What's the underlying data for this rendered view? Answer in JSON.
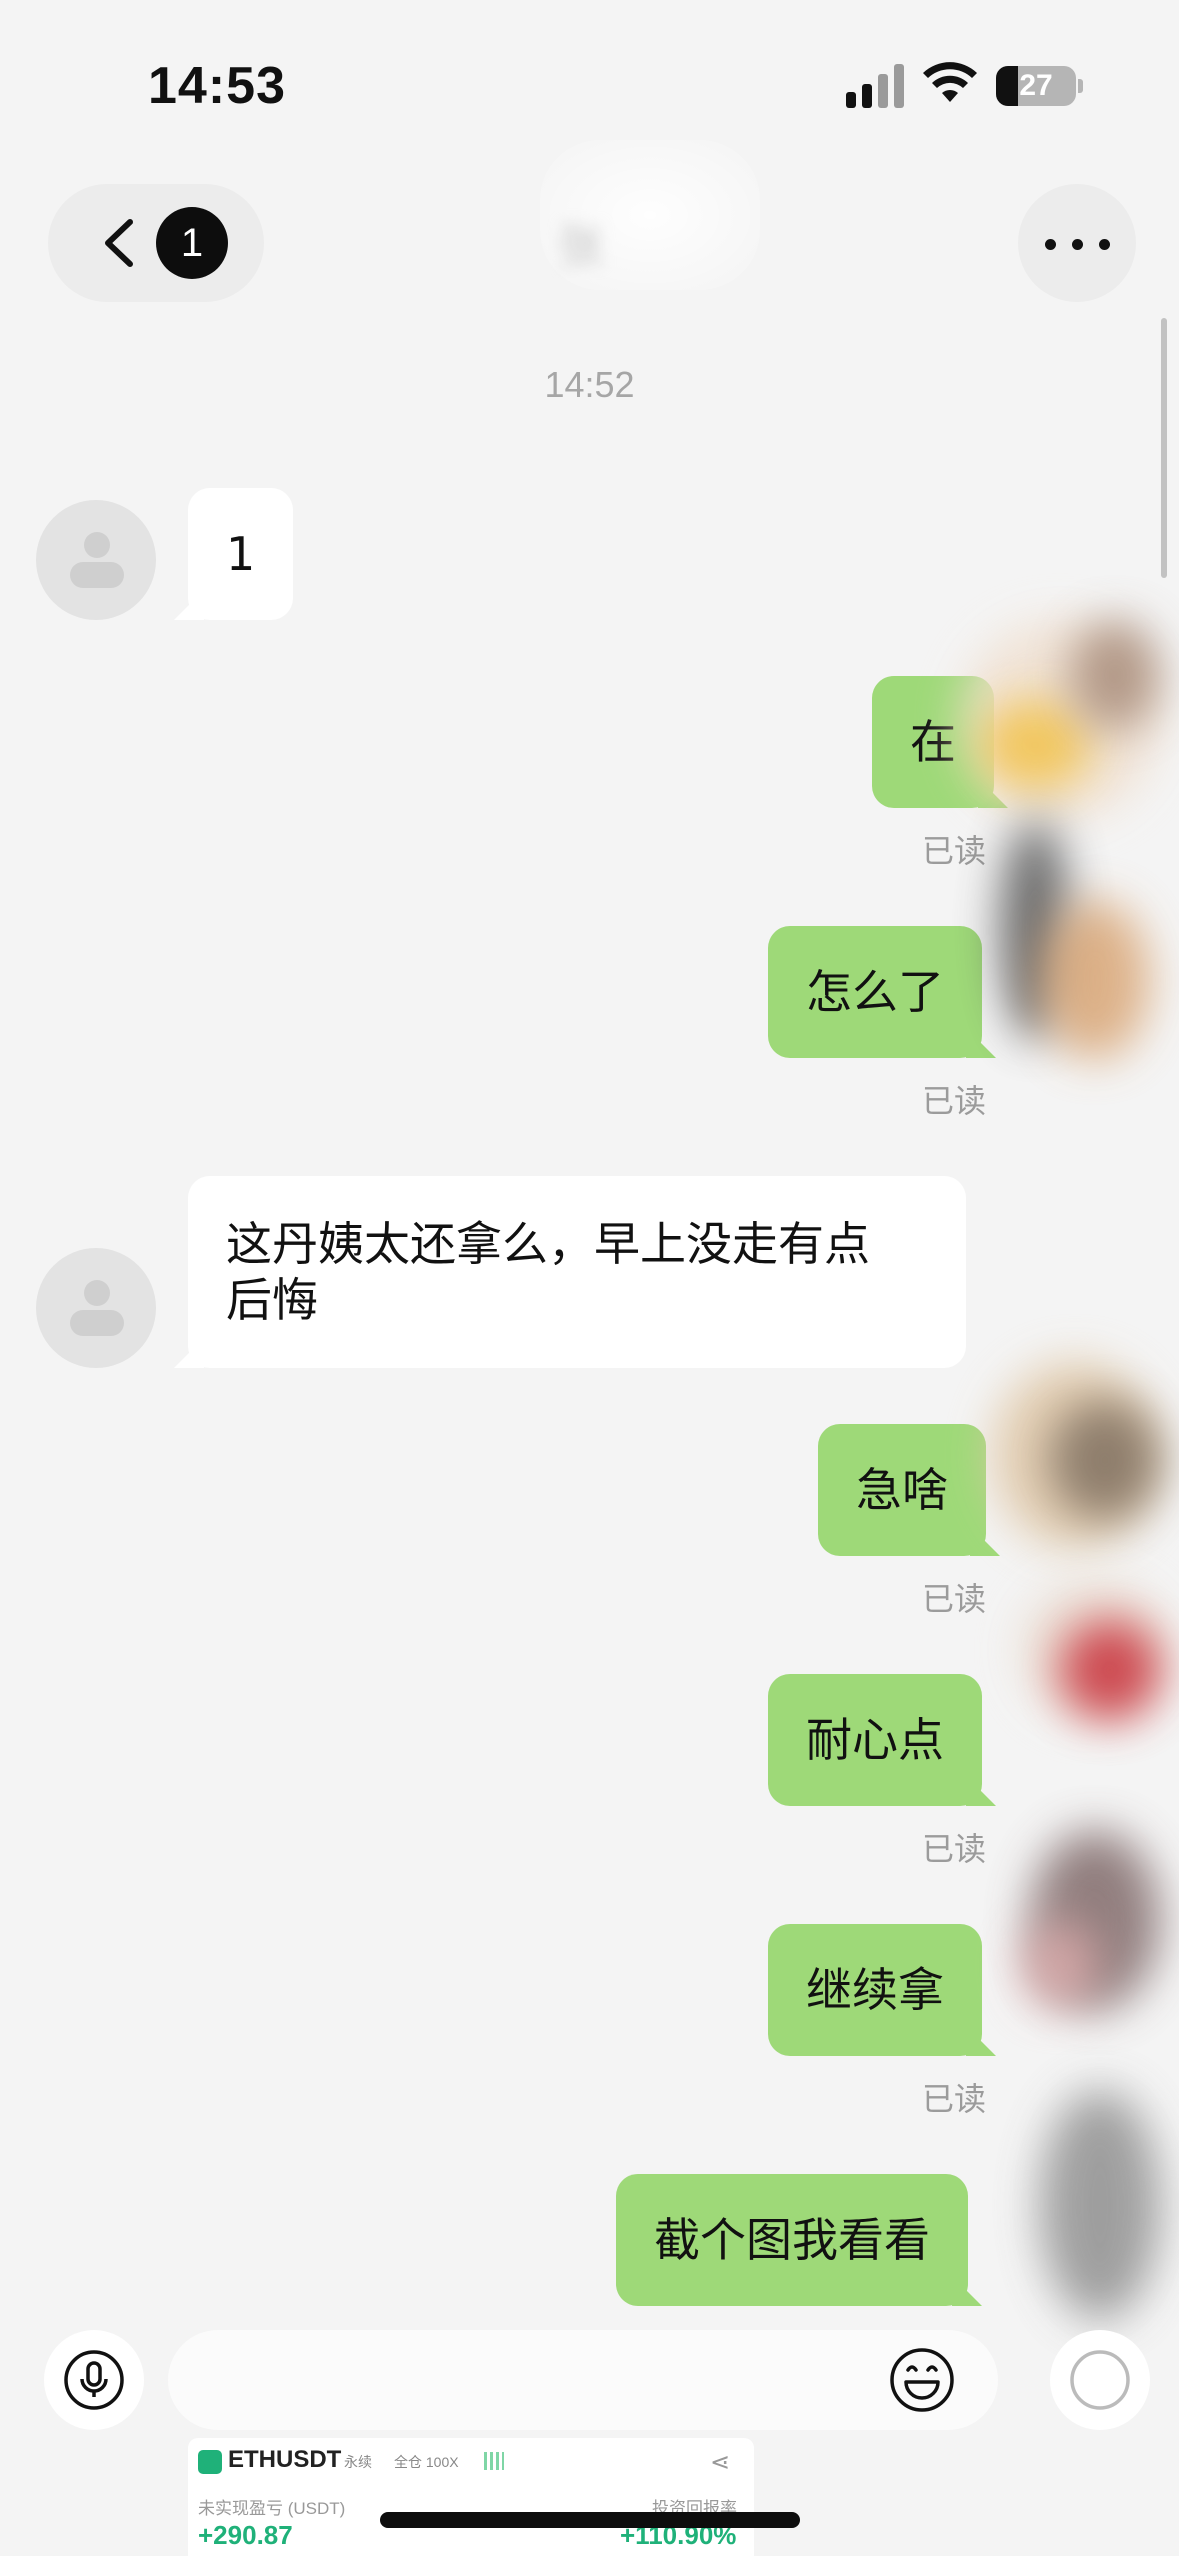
{
  "status_bar": {
    "time": "14:53",
    "battery_percent": "27",
    "battery_level": 0.27
  },
  "nav": {
    "unread_count": "1",
    "contact_name": "张"
  },
  "timestamp": "14:52",
  "messages": [
    {
      "side": "in",
      "text": "1"
    },
    {
      "side": "out",
      "text": "在",
      "status": "已读"
    },
    {
      "side": "out",
      "text": "怎么了",
      "status": "已读"
    },
    {
      "side": "in",
      "lines": [
        "这丹姨太还拿么，早上没走有点",
        "后悔"
      ]
    },
    {
      "side": "out",
      "text": "急啥",
      "status": "已读"
    },
    {
      "side": "out",
      "text": "耐心点",
      "status": "已读"
    },
    {
      "side": "out",
      "text": "继续拿",
      "status": "已读"
    },
    {
      "side": "out",
      "text": "截个图我看看"
    }
  ],
  "input": {
    "placeholder": ""
  },
  "preview": {
    "symbol": "ETHUSDT",
    "tag1": "永续",
    "tag2": "全仓 100X",
    "left_label": "未实现盈亏 (USDT)",
    "left_value": "+290.87",
    "right_label": "投资回报率",
    "right_value": "+110.90%"
  },
  "colors": {
    "outgoing_bubble": "#9ed978",
    "incoming_bubble": "#ffffff",
    "background": "#f4f4f4"
  },
  "icons": [
    "back-chevron-icon",
    "more-icon",
    "mic-icon",
    "emoji-icon",
    "plus-icon",
    "share-icon"
  ]
}
